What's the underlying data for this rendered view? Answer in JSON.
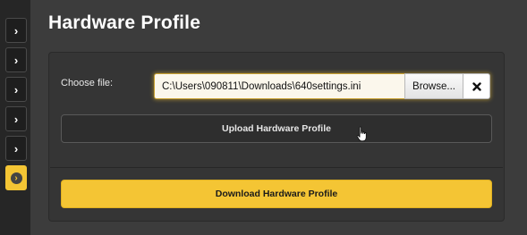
{
  "page": {
    "title": "Hardware Profile"
  },
  "sidebar": {
    "items": [
      {
        "icon": "chevron-right-icon",
        "glyph": "›",
        "active": false
      },
      {
        "icon": "chevron-right-icon",
        "glyph": "›",
        "active": false
      },
      {
        "icon": "chevron-right-icon",
        "glyph": "›",
        "active": false
      },
      {
        "icon": "chevron-right-icon",
        "glyph": "›",
        "active": false
      },
      {
        "icon": "chevron-right-icon",
        "glyph": "›",
        "active": false
      },
      {
        "icon": "chevron-right-circle-icon",
        "glyph": "›",
        "active": true
      }
    ]
  },
  "file": {
    "label": "Choose file:",
    "value": "C:\\Users\\090811\\Downloads\\640settings.ini",
    "browse_label": "Browse...",
    "clear_icon": "close-icon"
  },
  "actions": {
    "upload_label": "Upload Hardware Profile",
    "download_label": "Download Hardware Profile"
  },
  "colors": {
    "accent": "#f4c534",
    "background": "#3c3c3c",
    "panel": "#353535"
  }
}
